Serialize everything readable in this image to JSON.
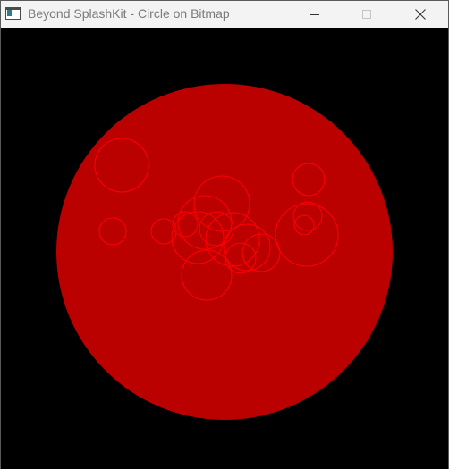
{
  "window": {
    "title": "Beyond SplashKit - Circle on Bitmap",
    "icon": "app-window-icon"
  },
  "controls": {
    "minimize_icon": "minimize-icon",
    "maximize_icon": "maximize-icon",
    "close_icon": "close-icon",
    "maximize_enabled": false
  },
  "canvas": {
    "background_color": "#000000",
    "main_circle_fill": "#bb0000",
    "outline_color": "#ff0000",
    "outlined_circle_count": 17
  }
}
